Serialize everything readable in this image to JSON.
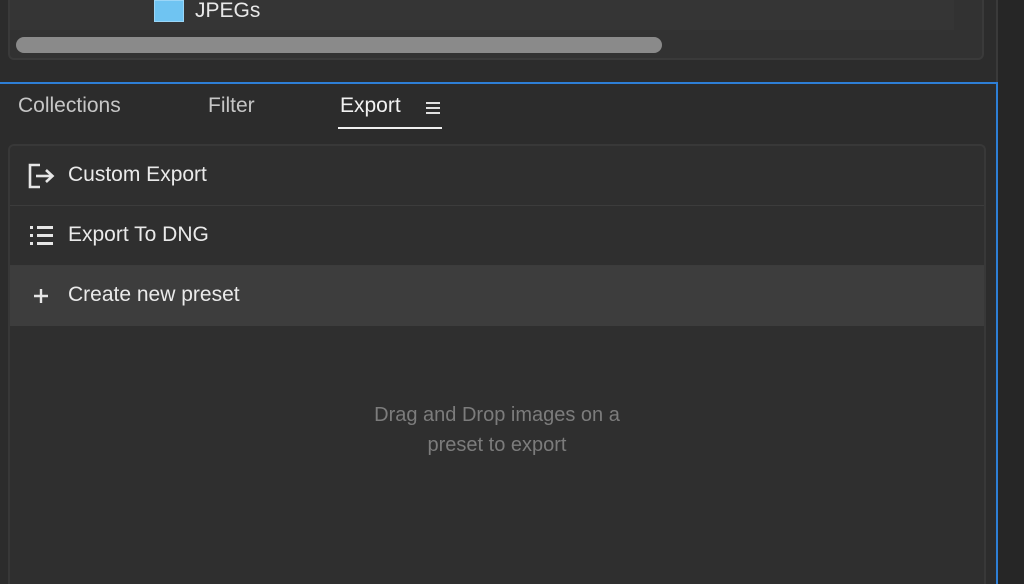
{
  "top_panel": {
    "folder": {
      "label": "JPEGs",
      "icon": "folder-icon",
      "icon_color": "#6fc4f2"
    }
  },
  "tabs": [
    {
      "label": "Collections",
      "active": false
    },
    {
      "label": "Filter",
      "active": false
    },
    {
      "label": "Export",
      "active": true
    }
  ],
  "tab_menu_icon": "hamburger-menu-icon",
  "presets": [
    {
      "label": "Custom Export",
      "icon": "export-icon"
    },
    {
      "label": "Export To DNG",
      "icon": "list-icon"
    },
    {
      "label": "Create new preset",
      "icon": "plus-icon"
    }
  ],
  "empty_hint": {
    "line1": "Drag and Drop images on a",
    "line2": "preset to export"
  },
  "colors": {
    "accent": "#2e7fd6",
    "background": "#2c2c2c",
    "highlight_row": "#3d3d3d"
  }
}
